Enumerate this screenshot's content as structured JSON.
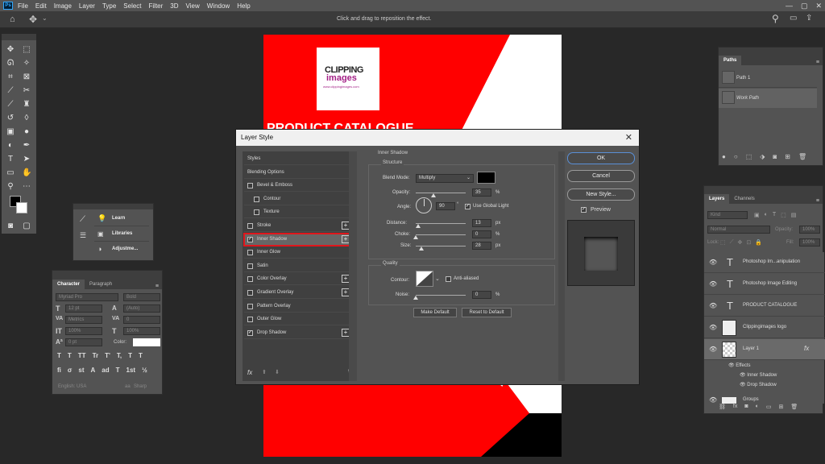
{
  "menu": [
    "File",
    "Edit",
    "Image",
    "Layer",
    "Type",
    "Select",
    "Filter",
    "3D",
    "View",
    "Window",
    "Help"
  ],
  "app_logo": "Ps",
  "options_hint": "Click and drag to reposition the effect.",
  "document": {
    "logo_line1": "CLIPPING",
    "logo_line2": "images",
    "logo_url": "www.clippingimages.com",
    "heading": "PRODUCT CATALOGUE"
  },
  "learn_panel": {
    "items": [
      "Learn",
      "Libraries",
      "Adjustme..."
    ]
  },
  "character_panel": {
    "tabs": [
      "Character",
      "Paragraph"
    ],
    "font": "Myriad Pro",
    "style": "Bold",
    "size": "12 pt",
    "leading": "(Auto)",
    "kerning": "Metrics",
    "tracking": "0",
    "vscale": "100%",
    "hscale": "100%",
    "baseline": "0 pt",
    "color_label": "Color:",
    "language": "English: USA",
    "aa": "Sharp",
    "type_buttons": [
      "T",
      "T",
      "TT",
      "Tr",
      "T'",
      "T,",
      "T",
      "T"
    ],
    "ot_buttons": [
      "fi",
      "σ",
      "st",
      "A",
      "ad",
      "T",
      "1st",
      "½"
    ]
  },
  "paths_panel": {
    "tab": "Paths",
    "items": [
      "Path 1",
      "Work Path"
    ]
  },
  "layers_panel": {
    "tabs": [
      "Layers",
      "Channels"
    ],
    "filter": "Kind",
    "blend": "Normal",
    "opacity_label": "Opacity:",
    "opacity": "100%",
    "lock_label": "Lock:",
    "fill_label": "Fill:",
    "fill": "100%",
    "layers": [
      {
        "name": "Photoshop Im...anipulation",
        "kind": "text"
      },
      {
        "name": "Photoshop Image Editing",
        "kind": "text"
      },
      {
        "name": "PRODUCT CATALOGUE",
        "kind": "text"
      },
      {
        "name": "Clippingimages logo",
        "kind": "smart"
      },
      {
        "name": "Layer 1",
        "kind": "pixel"
      }
    ],
    "fx_label": "fx",
    "effects_label": "Effects",
    "effects": [
      "Inner Shadow",
      "Drop Shadow"
    ],
    "partial_layer": "Groups"
  },
  "dialog": {
    "title": "Layer Style",
    "styles": [
      {
        "label": "Styles",
        "cb": false,
        "plus": false,
        "checked": false
      },
      {
        "label": "Blending Options",
        "cb": false,
        "plus": false,
        "checked": false
      },
      {
        "label": "Bevel & Emboss",
        "cb": true,
        "plus": false,
        "checked": false
      },
      {
        "label": "Contour",
        "cb": true,
        "plus": false,
        "checked": false,
        "indent": true
      },
      {
        "label": "Texture",
        "cb": true,
        "plus": false,
        "checked": false,
        "indent": true
      },
      {
        "label": "Stroke",
        "cb": true,
        "plus": true,
        "checked": false
      },
      {
        "label": "Inner Shadow",
        "cb": true,
        "plus": true,
        "checked": true,
        "selected": true
      },
      {
        "label": "Inner Glow",
        "cb": true,
        "plus": false,
        "checked": false
      },
      {
        "label": "Satin",
        "cb": true,
        "plus": false,
        "checked": false
      },
      {
        "label": "Color Overlay",
        "cb": true,
        "plus": true,
        "checked": false
      },
      {
        "label": "Gradient Overlay",
        "cb": true,
        "plus": true,
        "checked": false
      },
      {
        "label": "Pattern Overlay",
        "cb": true,
        "plus": false,
        "checked": false
      },
      {
        "label": "Outer Glow",
        "cb": true,
        "plus": false,
        "checked": false
      },
      {
        "label": "Drop Shadow",
        "cb": true,
        "plus": true,
        "checked": true
      }
    ],
    "footer_fx": "fx",
    "section_title": "Inner Shadow",
    "structure_title": "Structure",
    "blend_mode_label": "Blend Mode:",
    "blend_mode": "Multiply",
    "opacity_label": "Opacity:",
    "opacity": "35",
    "opacity_unit": "%",
    "opacity_frac": 0.35,
    "angle_label": "Angle:",
    "angle": "90",
    "angle_unit": "°",
    "use_global_light": "Use Global Light",
    "distance_label": "Distance:",
    "distance": "13",
    "distance_unit": "px",
    "distance_frac": 0.05,
    "choke_label": "Choke:",
    "choke": "0",
    "choke_unit": "%",
    "choke_frac": 0,
    "size_label": "Size:",
    "size": "28",
    "size_unit": "px",
    "size_frac": 0.11,
    "quality_title": "Quality",
    "contour_label": "Contour:",
    "anti_aliased": "Anti-aliased",
    "noise_label": "Noise:",
    "noise": "0",
    "noise_unit": "%",
    "noise_frac": 0,
    "make_default": "Make Default",
    "reset_default": "Reset to Default",
    "ok": "OK",
    "cancel": "Cancel",
    "new_style": "New Style...",
    "preview": "Preview",
    "shadow_color": "#000000"
  },
  "colors": {
    "accent_red": "#ff0000",
    "highlight_outline": "#e0161c",
    "ok_border": "#5a8fd6"
  }
}
